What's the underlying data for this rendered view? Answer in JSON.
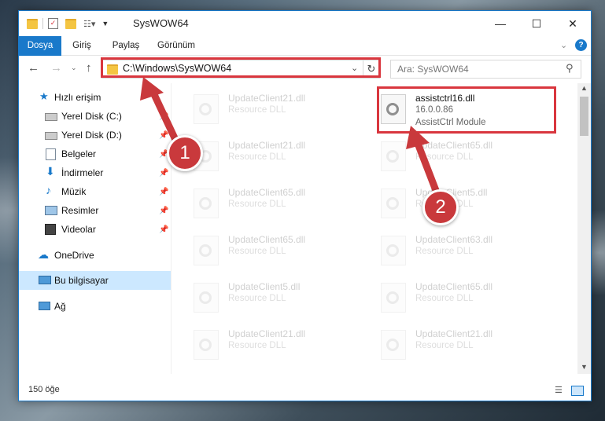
{
  "window": {
    "title": "SysWOW64",
    "minimize_glyph": "—",
    "maximize_glyph": "☐",
    "close_glyph": "✕"
  },
  "ribbon": {
    "tabs": [
      "Dosya",
      "Giriş",
      "Paylaş",
      "Görünüm"
    ],
    "accent": "#1979ca"
  },
  "nav": {
    "address": "C:\\Windows\\SysWOW64",
    "search_placeholder": "Ara: SysWOW64"
  },
  "sidebar": {
    "quick_access": "Hızlı erişim",
    "items": [
      {
        "label": "Yerel Disk (C:)",
        "icon": "drive-icon",
        "pinned": true
      },
      {
        "label": "Yerel Disk (D:)",
        "icon": "drive-icon",
        "pinned": true
      },
      {
        "label": "Belgeler",
        "icon": "documents-icon",
        "pinned": true
      },
      {
        "label": "İndirmeler",
        "icon": "downloads-icon",
        "pinned": true
      },
      {
        "label": "Müzik",
        "icon": "music-icon",
        "pinned": true
      },
      {
        "label": "Resimler",
        "icon": "pictures-icon",
        "pinned": true
      },
      {
        "label": "Videolar",
        "icon": "videos-icon",
        "pinned": true
      }
    ],
    "onedrive": "OneDrive",
    "this_pc": "Bu bilgisayar",
    "network": "Ağ"
  },
  "files": {
    "highlight": {
      "name": "assistctrl16.dll",
      "version": "16.0.0.86",
      "type": "AssistCtrl Module"
    },
    "left_column": [
      {
        "name": "UpdateClient21.dll",
        "type": "Resource DLL"
      },
      {
        "name": "UpdateClient21.dll",
        "type": "Resource DLL"
      },
      {
        "name": "UpdateClient65.dll",
        "type": "Resource DLL"
      },
      {
        "name": "UpdateClient65.dll",
        "type": "Resource DLL"
      },
      {
        "name": "UpdateClient5.dll",
        "type": "Resource DLL"
      },
      {
        "name": "UpdateClient21.dll",
        "type": "Resource DLL"
      }
    ],
    "right_column": [
      {
        "name": "UpdateClient65.dll",
        "type": "Resource DLL"
      },
      {
        "name": "UpdateClient5.dll",
        "type": "Resource DLL"
      },
      {
        "name": "UpdateClient63.dll",
        "type": "Resource DLL"
      },
      {
        "name": "UpdateClient65.dll",
        "type": "Resource DLL"
      },
      {
        "name": "UpdateClient21.dll",
        "type": "Resource DLL"
      }
    ]
  },
  "status": {
    "count": "150 öğe"
  },
  "annotations": {
    "badge_1": "1",
    "badge_2": "2",
    "color": "#d9363e"
  }
}
